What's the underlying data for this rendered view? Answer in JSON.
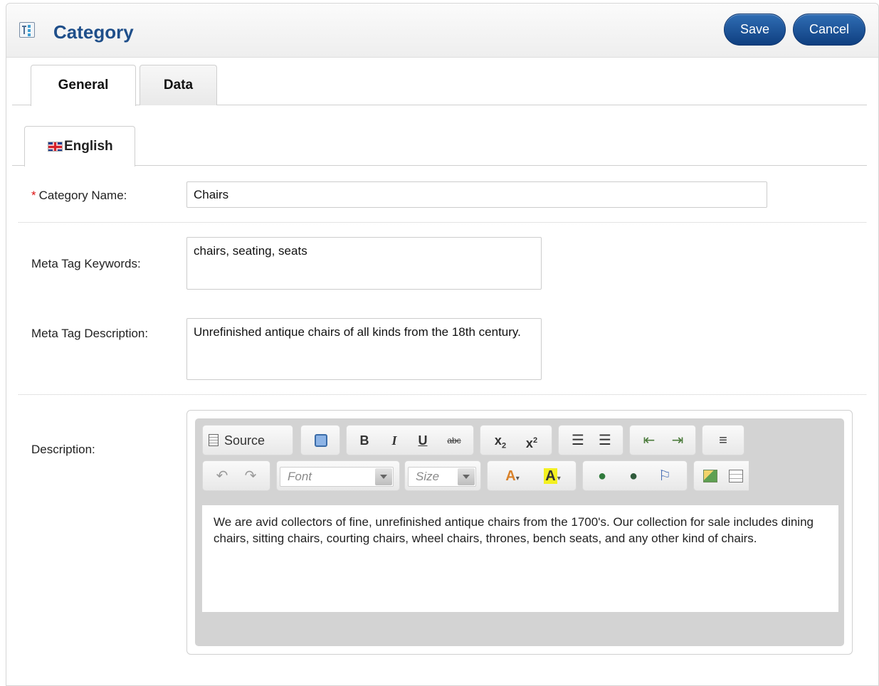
{
  "header": {
    "title": "Category",
    "icon": "category-icon"
  },
  "actions": {
    "save": "Save",
    "cancel": "Cancel"
  },
  "tabs": [
    {
      "label": "General",
      "active": true
    },
    {
      "label": "Data",
      "active": false
    }
  ],
  "language_tab": {
    "label": "English",
    "icon": "uk-flag-icon"
  },
  "form": {
    "category_name": {
      "label": "Category Name:",
      "required_mark": "*",
      "value": "Chairs"
    },
    "meta_keywords": {
      "label": "Meta Tag Keywords:",
      "value": "chairs, seating, seats"
    },
    "meta_description": {
      "label": "Meta Tag Description:",
      "value": "Unrefinished antique chairs of all kinds from the 18th century."
    },
    "description": {
      "label": "Description:",
      "value": "We are avid collectors of fine, unrefinished antique chairs from the 1700's. Our collection for sale includes dining chairs, sitting chairs, courting chairs, wheel chairs, thrones, bench seats, and any other kind of chairs."
    }
  },
  "editor": {
    "source_label": "Source",
    "font_placeholder": "Font",
    "size_placeholder": "Size"
  },
  "colors": {
    "accent": "#1f4f8a",
    "button": "#154a8c",
    "required": "#dd1111"
  }
}
